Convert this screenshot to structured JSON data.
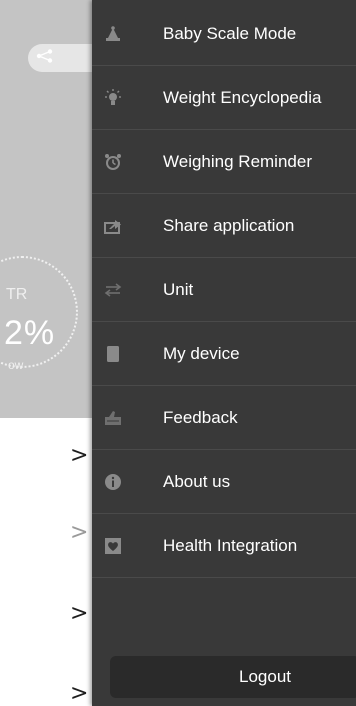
{
  "background": {
    "gauge": {
      "label_top": "TR",
      "value": "2%",
      "caption": "ow"
    },
    "chevrons": [
      ">",
      ">",
      ">",
      ">"
    ]
  },
  "drawer": {
    "items": [
      {
        "label": "Baby Scale Mode",
        "icon": "baby-scale-icon"
      },
      {
        "label": "Weight Encyclopedia",
        "icon": "lightbulb-icon"
      },
      {
        "label": "Weighing Reminder",
        "icon": "alarm-clock-icon"
      },
      {
        "label": "Share application",
        "icon": "share-icon"
      },
      {
        "label": "Unit",
        "icon": "swap-arrows-icon"
      },
      {
        "label": "My device",
        "icon": "device-icon"
      },
      {
        "label": "Feedback",
        "icon": "feedback-icon"
      },
      {
        "label": "About us",
        "icon": "info-icon"
      },
      {
        "label": "Health Integration",
        "icon": "heart-icon"
      }
    ],
    "logout_label": "Logout"
  },
  "colors": {
    "drawer_bg": "#393939",
    "background_panel": "#c4c4c4",
    "text": "#ffffff"
  }
}
